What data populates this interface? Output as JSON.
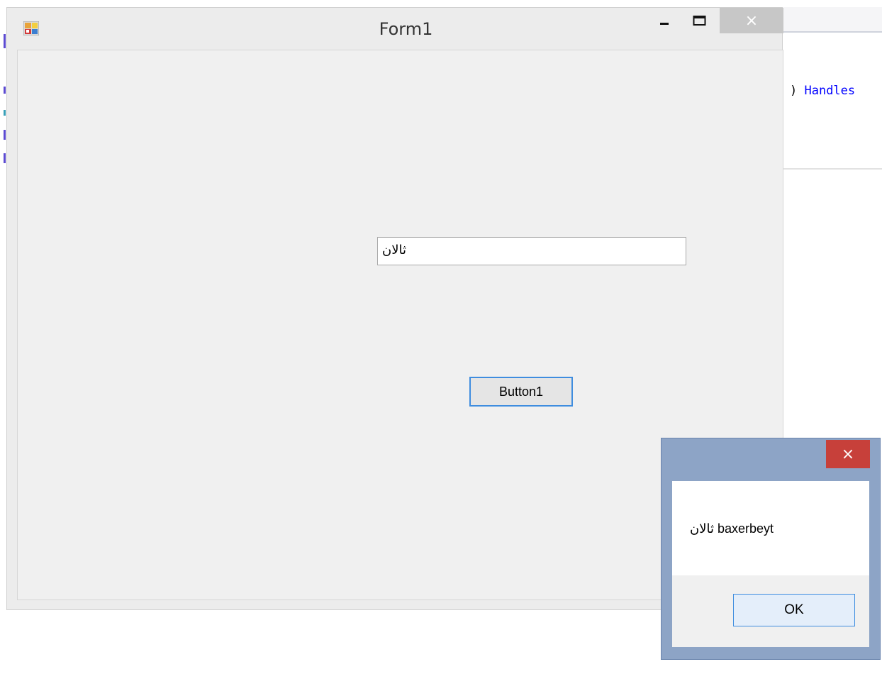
{
  "editor": {
    "code_paren": ") ",
    "code_keyword": "Handles",
    "keyword_color": "#0000ff"
  },
  "form": {
    "title": "Form1",
    "app_icon": "windows-form-icon",
    "minimize_icon": "minimize-icon",
    "maximize_icon": "maximize-icon",
    "close_glyph": "×",
    "textbox_value": "ثالان",
    "button_label": "Button1",
    "accent_color": "#3f8ddf"
  },
  "message_box": {
    "close_glyph": "×",
    "close_color": "#c7403a",
    "frame_color": "#8da4c6",
    "message": "ثالان baxerbeyt",
    "ok_label": "OK"
  }
}
